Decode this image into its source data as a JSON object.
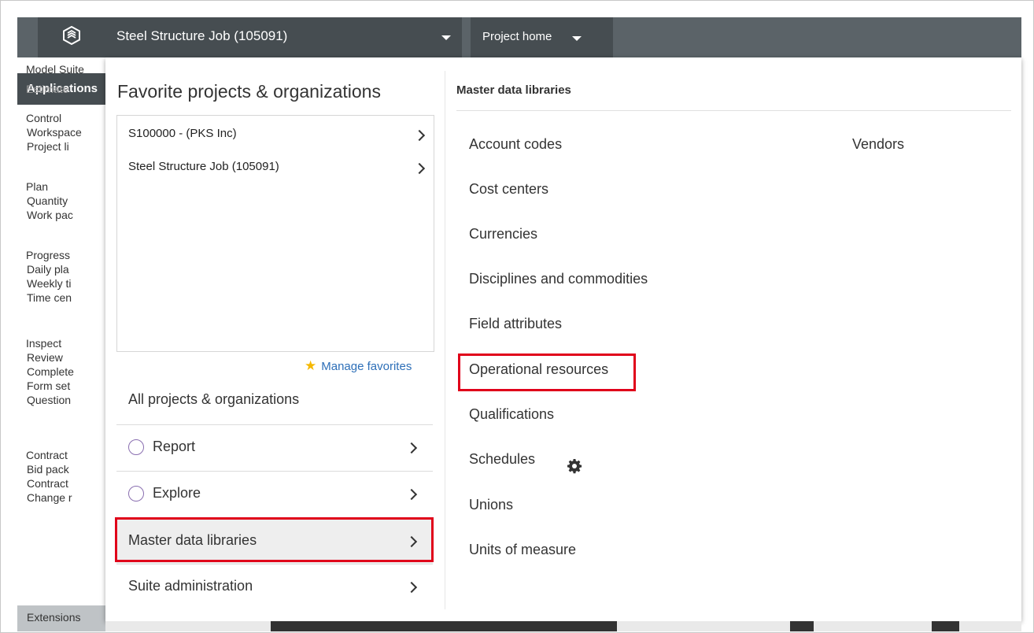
{
  "topbar": {
    "project_select_label": "Steel Structure Job (105091)",
    "project_home_label": "Project home"
  },
  "sidebar": {
    "header": "Applications",
    "lines": [
      {
        "text": "Model Suite",
        "dim": false,
        "indent": false
      },
      {
        "text": "Estimate",
        "dim": true,
        "indent": false
      },
      {
        "text": "Control",
        "dim": false,
        "indent": false
      },
      {
        "text": "Workspace",
        "dim": false,
        "indent": true
      },
      {
        "text": "Project li",
        "dim": false,
        "indent": true
      },
      {
        "text": "Plan",
        "dim": false,
        "indent": false
      },
      {
        "text": "Quantity",
        "dim": false,
        "indent": true
      },
      {
        "text": "Work pac",
        "dim": false,
        "indent": true
      },
      {
        "text": "Progress",
        "dim": false,
        "indent": false
      },
      {
        "text": "Daily pla",
        "dim": false,
        "indent": true
      },
      {
        "text": "Weekly ti",
        "dim": false,
        "indent": true
      },
      {
        "text": "Time cen",
        "dim": false,
        "indent": true
      },
      {
        "text": "Inspect",
        "dim": false,
        "indent": false
      },
      {
        "text": "Review",
        "dim": false,
        "indent": true
      },
      {
        "text": "Complete",
        "dim": false,
        "indent": true
      },
      {
        "text": "Form set",
        "dim": false,
        "indent": true
      },
      {
        "text": "Question",
        "dim": false,
        "indent": true
      },
      {
        "text": "Contract",
        "dim": false,
        "indent": false
      },
      {
        "text": "Bid pack",
        "dim": false,
        "indent": true
      },
      {
        "text": "Contract",
        "dim": false,
        "indent": true
      },
      {
        "text": "Change r",
        "dim": false,
        "indent": true
      }
    ],
    "extensions": "Extensions"
  },
  "favorites": {
    "title": "Favorite projects & organizations",
    "items": [
      "S100000 - (PKS Inc)",
      "Steel Structure Job (105091)"
    ],
    "manage_label": "Manage favorites"
  },
  "all_projects_label": "All projects & organizations",
  "menu": [
    {
      "label": "Report",
      "icon": "report-icon"
    },
    {
      "label": "Explore",
      "icon": "explore-icon"
    },
    {
      "label": "Master data libraries",
      "icon": ""
    },
    {
      "label": "Suite administration",
      "icon": ""
    }
  ],
  "master_data": {
    "title": "Master data libraries",
    "left_column": [
      "Account codes",
      "Cost centers",
      "Currencies",
      "Disciplines and commodities",
      "Field attributes",
      "Operational resources",
      "Qualifications",
      "Schedules",
      "Unions",
      "Units of measure"
    ],
    "right_column": [
      "Vendors"
    ]
  },
  "colors": {
    "topbar": "#5b6368",
    "topbar_dark": "#464d51",
    "highlight": "#e0001a",
    "link": "#2d6fb8"
  }
}
